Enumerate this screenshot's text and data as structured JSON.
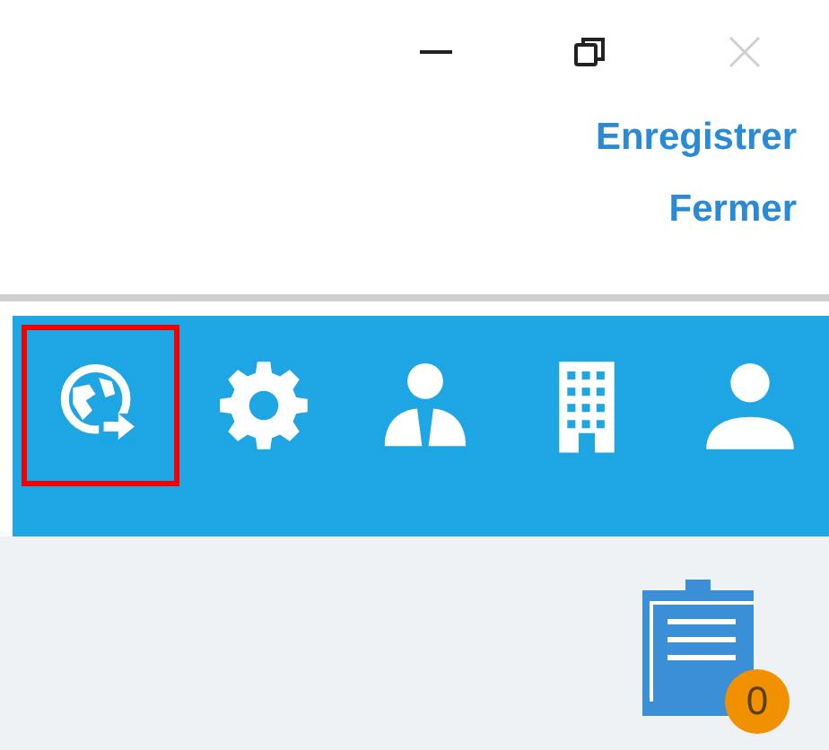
{
  "window_controls": [
    {
      "kind": "minimize",
      "disabled": false
    },
    {
      "kind": "restore",
      "disabled": false
    },
    {
      "kind": "close",
      "disabled": true
    }
  ],
  "actions": [
    "Enregistrer",
    "Fermer"
  ],
  "toolbar": {
    "items": [
      {
        "kind": "globe",
        "selected": true
      },
      {
        "kind": "gear",
        "selected": false
      },
      {
        "kind": "agent",
        "selected": false
      },
      {
        "kind": "building",
        "selected": false
      },
      {
        "kind": "user",
        "selected": false
      }
    ]
  },
  "tasks": {
    "badge": "0"
  }
}
